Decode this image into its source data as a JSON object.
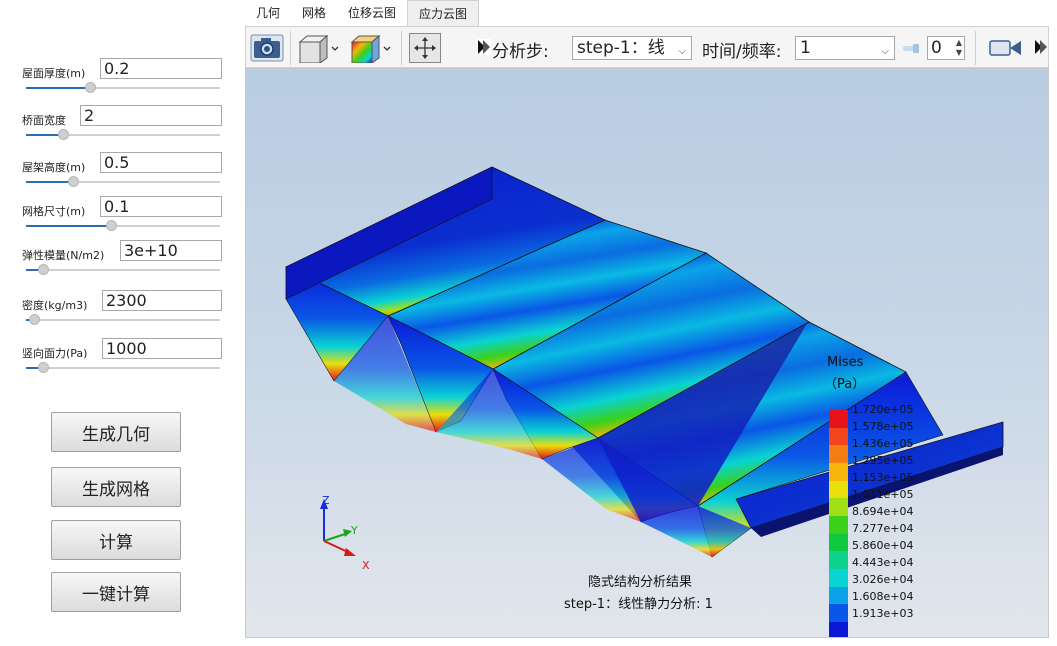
{
  "tabs": [
    {
      "label": "几何"
    },
    {
      "label": "网格"
    },
    {
      "label": "位移云图"
    },
    {
      "label": "应力云图",
      "active": true
    }
  ],
  "params": [
    {
      "label": "屋面厚度(m)",
      "value": "0.2",
      "slider_fraction": 0.33
    },
    {
      "label": "桥面宽度",
      "value": "2",
      "slider_fraction": 0.19
    },
    {
      "label": "屋架高度(m)",
      "value": "0.5",
      "slider_fraction": 0.24
    },
    {
      "label": "网格尺寸(m)",
      "value": "0.1",
      "slider_fraction": 0.44
    },
    {
      "label": "弹性模量(N/m2)",
      "value": "3e+10",
      "slider_fraction": 0.09
    },
    {
      "label": "密度(kg/m3)",
      "value": "2300",
      "slider_fraction": 0.04
    },
    {
      "label": "竖向面力(Pa)",
      "value": "1000",
      "slider_fraction": 0.09
    }
  ],
  "buttons": {
    "gen_geometry": "生成几何",
    "gen_mesh": "生成网格",
    "compute": "计算",
    "one_click": "一键计算"
  },
  "toolbar": {
    "step_label": "分析步:",
    "step_value": "step-1：线",
    "freq_label": "时间/频率:",
    "freq_value": "1",
    "frame_value": "0",
    "icons": [
      "camera-icon",
      "cube-view-icon",
      "color-map-icon",
      "fit-view-icon",
      "play-icon",
      "video-record-icon"
    ]
  },
  "legend": {
    "title": "Mises",
    "unit": "（Pa）",
    "labels": [
      "1.720e+05",
      "1.578e+05",
      "1.436e+05",
      "1.295e+05",
      "1.153e+05",
      "1.011e+05",
      "8.694e+04",
      "7.277e+04",
      "5.860e+04",
      "4.443e+04",
      "3.026e+04",
      "1.608e+04",
      "1.913e+03"
    ],
    "colors": [
      "#e8121b",
      "#f2451c",
      "#f57e14",
      "#f8b50b",
      "#e8e00b",
      "#a2e015",
      "#3ad11a",
      "#0ec93f",
      "#0dd28f",
      "#0ad3d3",
      "#0ba3e8",
      "#0a56e6",
      "#0b18d8"
    ]
  },
  "caption": {
    "line1": "隐式结构分析结果",
    "line2": "step-1：线性静力分析: 1"
  },
  "axes": {
    "x": "X",
    "y": "Y",
    "z": "Z"
  }
}
